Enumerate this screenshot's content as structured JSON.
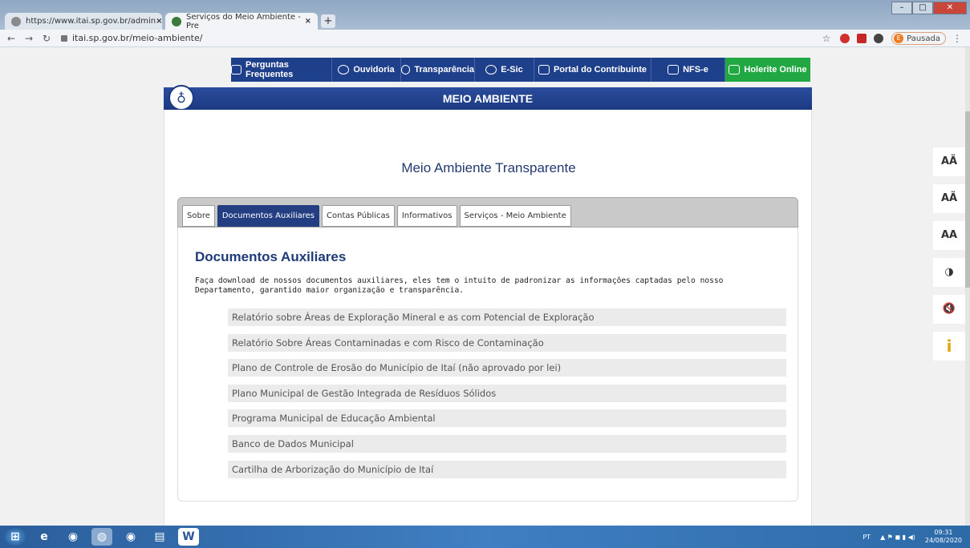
{
  "browser": {
    "tabs": [
      {
        "title": "https://www.itai.sp.gov.br/admin",
        "close": "×"
      },
      {
        "title": "Serviços do Meio Ambiente - Pre",
        "close": "×"
      }
    ],
    "new_tab": "+",
    "url": "itai.sp.gov.br/meio-ambiente/",
    "profile_label": "Pausada",
    "profile_initial": "E"
  },
  "topnav": {
    "items": [
      {
        "label": "Perguntas Frequentes"
      },
      {
        "label": "Ouvidoria"
      },
      {
        "label": "Transparência"
      },
      {
        "label": "E-Sic"
      },
      {
        "label": "Portal do Contribuinte"
      },
      {
        "label": "NFS-e"
      },
      {
        "label": "Holerite Online"
      }
    ]
  },
  "section": {
    "title": "MEIO AMBIENTE"
  },
  "page": {
    "title": "Meio Ambiente Transparente"
  },
  "tabs": [
    {
      "label": "Sobre"
    },
    {
      "label": "Documentos Auxiliares"
    },
    {
      "label": "Contas Públicas"
    },
    {
      "label": "Informativos"
    },
    {
      "label": "Serviços - Meio Ambiente"
    }
  ],
  "documents": {
    "title": "Documentos Auxiliares",
    "description": "Faça download de nossos documentos auxiliares, eles tem o intuito de padronizar as informações captadas pelo nosso Departamento, garantido maior organização e transparência.",
    "items": [
      "Relatório sobre Áreas de Exploração Mineral e as com Potencial de Exploração",
      "Relatório Sobre Áreas Contaminadas e com Risco de Contaminação",
      "Plano de Controle de Erosão do Município de Itaí (não aprovado por lei)",
      "Plano Municipal de Gestão Integrada de Resíduos Sólidos",
      "Programa Municipal de Educação Ambiental",
      "Banco de Dados Municipal",
      "Cartilha de Arborização do Município de Itaí"
    ]
  },
  "accessibility": {
    "items": [
      "AÄ",
      "AÄ",
      "AA",
      "◑",
      "🔇",
      "i"
    ]
  },
  "taskbar": {
    "lang": "PT",
    "time": "09:31",
    "date": "24/08/2020"
  },
  "colors": {
    "nav_blue": "#1e3f8a",
    "green": "#21a842",
    "active_tab": "#233f82"
  }
}
